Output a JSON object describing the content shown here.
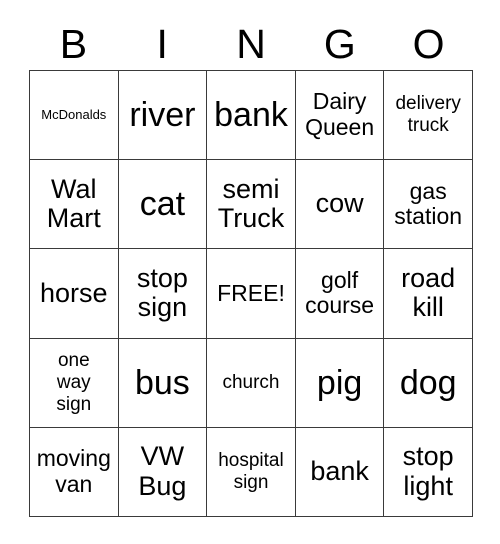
{
  "card": {
    "title_letters": [
      "B",
      "I",
      "N",
      "G",
      "O"
    ],
    "columns": 5,
    "rows": 5,
    "border_color": "#3a3a3a",
    "background_color": "#ffffff",
    "text_color": "#000000",
    "free_space_label": "FREE!",
    "free_space_position": "row3-col3",
    "cells": [
      [
        {
          "text": "McDonalds",
          "size": "xs"
        },
        {
          "text": "river",
          "size": "xl"
        },
        {
          "text": "bank",
          "size": "xl"
        },
        {
          "text": "Dairy\nQueen",
          "size": "m"
        },
        {
          "text": "delivery\ntruck",
          "size": "s"
        }
      ],
      [
        {
          "text": "Wal\nMart",
          "size": "l"
        },
        {
          "text": "cat",
          "size": "xl"
        },
        {
          "text": "semi\nTruck",
          "size": "l"
        },
        {
          "text": "cow",
          "size": "l"
        },
        {
          "text": "gas\nstation",
          "size": "m"
        }
      ],
      [
        {
          "text": "horse",
          "size": "l"
        },
        {
          "text": "stop\nsign",
          "size": "l"
        },
        {
          "text": "FREE!",
          "size": "m"
        },
        {
          "text": "golf\ncourse",
          "size": "m"
        },
        {
          "text": "road\nkill",
          "size": "l"
        }
      ],
      [
        {
          "text": "one\nway\nsign",
          "size": "s"
        },
        {
          "text": "bus",
          "size": "xl"
        },
        {
          "text": "church",
          "size": "s"
        },
        {
          "text": "pig",
          "size": "xl"
        },
        {
          "text": "dog",
          "size": "xl"
        }
      ],
      [
        {
          "text": "moving\nvan",
          "size": "m"
        },
        {
          "text": "VW\nBug",
          "size": "l"
        },
        {
          "text": "hospital\nsign",
          "size": "s"
        },
        {
          "text": "bank",
          "size": "l"
        },
        {
          "text": "stop\nlight",
          "size": "l"
        }
      ]
    ]
  }
}
